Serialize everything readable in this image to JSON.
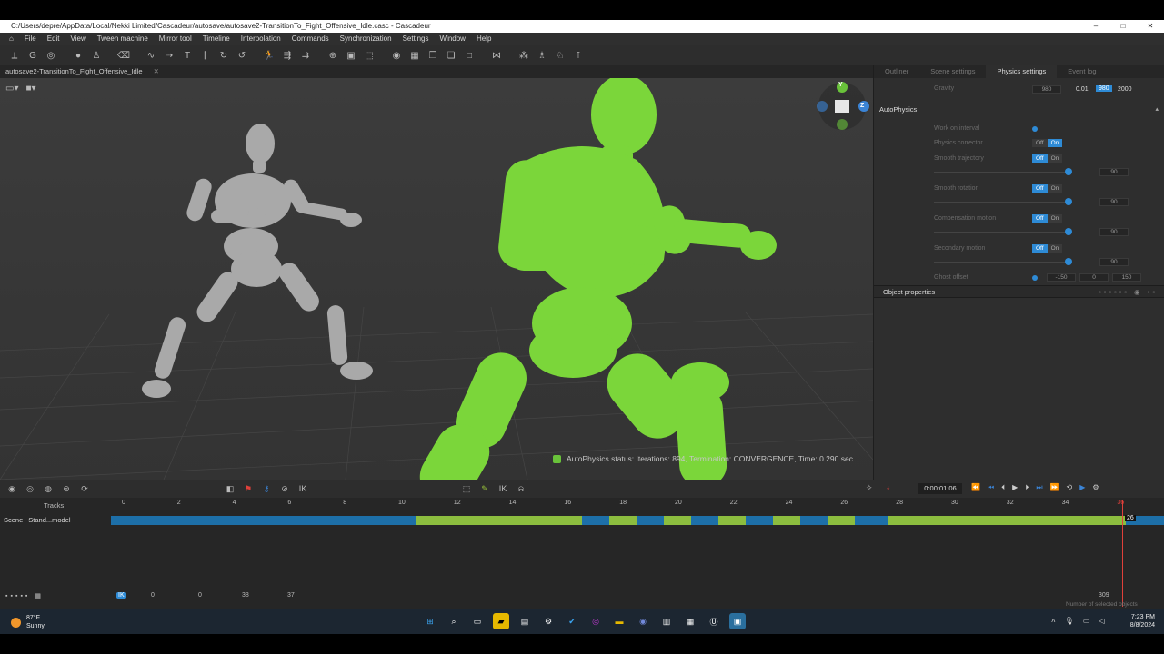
{
  "window": {
    "title": "C:/Users/depre/AppData/Local/Nekki Limited/Cascadeur/autosave/autosave2-TransitionTo_Fight_Offensive_Idle.casc - Cascadeur",
    "controls": [
      "–",
      "□",
      "✕"
    ]
  },
  "menu": [
    "File",
    "Edit",
    "View",
    "Tween machine",
    "Mirror tool",
    "Timeline",
    "Interpolation",
    "Commands",
    "Synchronization",
    "Settings",
    "Window",
    "Help"
  ],
  "doc_tab": {
    "label": "autosave2-TransitionTo_Fight_Offensive_Idle",
    "close": "✕"
  },
  "viewport": {
    "status": "AutoPhysics status: Iterations: 894, Termination: CONVERGENCE, Time: 0.290 sec.",
    "gizmo": {
      "y": "Y",
      "z": "Z"
    },
    "figure_color": "#7bd63a",
    "ghost_color": "#a8a8a8"
  },
  "right_panel": {
    "tabs": [
      "Outliner",
      "Scene settings",
      "Physics settings",
      "Event log"
    ],
    "active_tab": "Physics settings",
    "gravity": {
      "label": "Gravity",
      "value": "980",
      "v1": "0.01",
      "v2": "980",
      "v3": "2000"
    },
    "section": "AutoPhysics",
    "rows": [
      {
        "label": "Work on interval"
      },
      {
        "label": "Physics corrector",
        "off": "Off",
        "on": "On"
      },
      {
        "label": "Smooth trajectory",
        "off": "Off",
        "on": "On",
        "num": "90"
      },
      {
        "label": "Smooth rotation",
        "off": "Off",
        "on": "On",
        "num": "90"
      },
      {
        "label": "Compensation motion",
        "off": "Off",
        "on": "On",
        "num": "90"
      },
      {
        "label": "Secondary motion",
        "off": "Off",
        "on": "On",
        "num": "90"
      }
    ],
    "ghost_offset": {
      "label": "Ghost offset",
      "a": "-150",
      "b": "0",
      "c": "150"
    },
    "object_properties": "Object properties"
  },
  "timeline": {
    "timecode": "0:00:01:06",
    "tracks_label": "Tracks",
    "scene_label": "Scene",
    "model_label": "Stand...model",
    "ticks": [
      "0",
      "2",
      "4",
      "6",
      "8",
      "10",
      "12",
      "14",
      "16",
      "18",
      "20",
      "22",
      "24",
      "26",
      "28",
      "30",
      "32",
      "34",
      "36"
    ],
    "current_frame": "26",
    "bottom": {
      "ik": "IK",
      "a": "0",
      "b": "0",
      "c": "38",
      "d": "37",
      "total": "309",
      "selected": "Number of selected objects"
    }
  },
  "taskbar": {
    "temp": "87°F",
    "weather": "Sunny",
    "time": "7:23 PM",
    "date": "8/8/2024"
  }
}
